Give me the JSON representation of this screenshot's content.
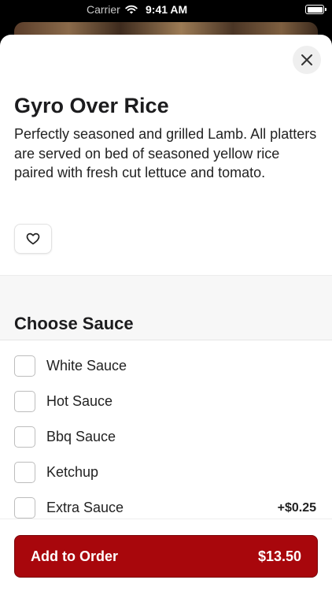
{
  "status_bar": {
    "carrier": "Carrier",
    "time": "9:41 AM"
  },
  "item": {
    "title": "Gyro Over Rice",
    "description": "Perfectly seasoned and grilled Lamb. All platters are served on bed of seasoned yellow rice paired with fresh cut lettuce and tomato."
  },
  "section": {
    "title": "Choose Sauce"
  },
  "options": [
    {
      "label": "White Sauce",
      "price": "",
      "checked": false
    },
    {
      "label": "Hot Sauce",
      "price": "",
      "checked": false
    },
    {
      "label": "Bbq Sauce",
      "price": "",
      "checked": false
    },
    {
      "label": "Ketchup",
      "price": "",
      "checked": false
    },
    {
      "label": "Extra Sauce",
      "price": "+$0.25",
      "checked": false
    }
  ],
  "cta": {
    "label": "Add to Order",
    "price": "$13.50"
  },
  "colors": {
    "accent": "#a8070c",
    "sheet_background": "#ffffff",
    "section_background": "#f7f7f7"
  },
  "icons": {
    "close": "close-icon",
    "favorite": "heart-icon",
    "wifi": "wifi-icon",
    "battery": "battery-icon"
  }
}
